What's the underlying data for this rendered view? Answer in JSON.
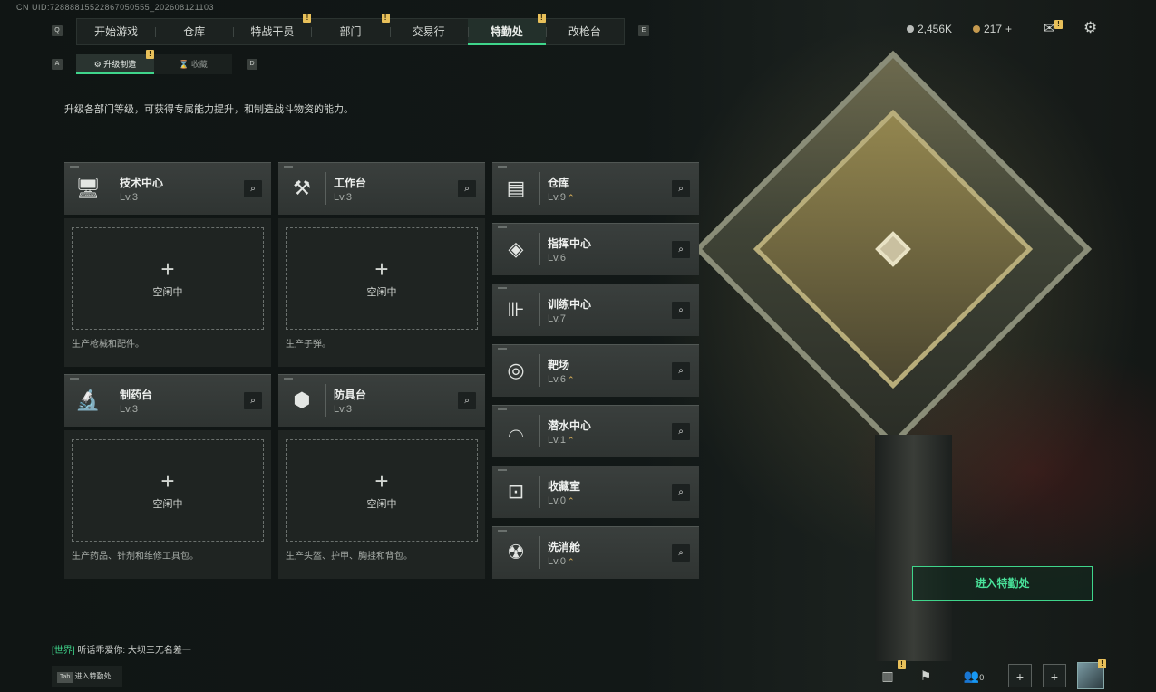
{
  "uid": "CN UID:72888815522867050555_202608121103",
  "nav": {
    "key_left": "Q",
    "key_right": "E",
    "tabs": [
      {
        "label": "开始游戏",
        "badge": ""
      },
      {
        "label": "仓库",
        "badge": ""
      },
      {
        "label": "特战干员",
        "badge": "!"
      },
      {
        "label": "部门",
        "badge": "!"
      },
      {
        "label": "交易行",
        "badge": ""
      },
      {
        "label": "特勤处",
        "badge": "!"
      },
      {
        "label": "改枪台",
        "badge": ""
      }
    ]
  },
  "subnav": {
    "key_left": "A",
    "key_right": "D",
    "tabs": [
      {
        "label": "升级制造",
        "badge": "!"
      },
      {
        "label": "收藏",
        "badge": ""
      }
    ]
  },
  "currency": {
    "silver": "2,456K",
    "gold": "217",
    "gold_add": "+"
  },
  "description": "升级各部门等级，可获得专属能力提升，和制造战斗物资的能力。",
  "production": [
    {
      "name": "技术中心",
      "level": "Lv.3",
      "icon": "monitor-icon",
      "glyph": "🖥",
      "status": "空闲中",
      "sub": "生产枪械和配件。"
    },
    {
      "name": "工作台",
      "level": "Lv.3",
      "icon": "tools-icon",
      "glyph": "⚒",
      "status": "空闲中",
      "sub": "生产子弹。"
    },
    {
      "name": "制药台",
      "level": "Lv.3",
      "icon": "microscope-icon",
      "glyph": "🔬",
      "status": "空闲中",
      "sub": "生产药品、针剂和维修工具包。"
    },
    {
      "name": "防具台",
      "level": "Lv.3",
      "icon": "armor-icon",
      "glyph": "⬢",
      "status": "空闲中",
      "sub": "生产头盔、护甲、胸挂和背包。"
    }
  ],
  "departments": [
    {
      "name": "仓库",
      "level": "Lv.9",
      "upgradable": true,
      "icon": "warehouse-icon",
      "glyph": "▤"
    },
    {
      "name": "指挥中心",
      "level": "Lv.6",
      "upgradable": false,
      "icon": "command-icon",
      "glyph": "◈"
    },
    {
      "name": "训练中心",
      "level": "Lv.7",
      "upgradable": false,
      "icon": "dumbbell-icon",
      "glyph": "⊪"
    },
    {
      "name": "靶场",
      "level": "Lv.6",
      "upgradable": true,
      "icon": "target-icon",
      "glyph": "◎"
    },
    {
      "name": "潜水中心",
      "level": "Lv.1",
      "upgradable": true,
      "icon": "diving-mask-icon",
      "glyph": "⌓"
    },
    {
      "name": "收藏室",
      "level": "Lv.0",
      "upgradable": true,
      "icon": "collection-icon",
      "glyph": "⊡"
    },
    {
      "name": "洗消舱",
      "level": "Lv.0",
      "upgradable": true,
      "icon": "decon-icon",
      "glyph": "☢"
    }
  ],
  "upgrade_symbol": "⌃",
  "plus_symbol": "+",
  "search_symbol": "⌕",
  "enter_button": "进入特勤处",
  "chat": {
    "channel": "[世界]",
    "sender": "听话乖爱你:",
    "message": "大坝三无名差一"
  },
  "tab_hint": {
    "key": "Tab",
    "label": "进入特勤处"
  },
  "bottom_bar": {
    "friends_count": "0",
    "notification_badge": "!"
  },
  "colors": {
    "accent": "#3fd58b",
    "badge": "#e8c05a",
    "upgrade": "#e0b55c"
  }
}
